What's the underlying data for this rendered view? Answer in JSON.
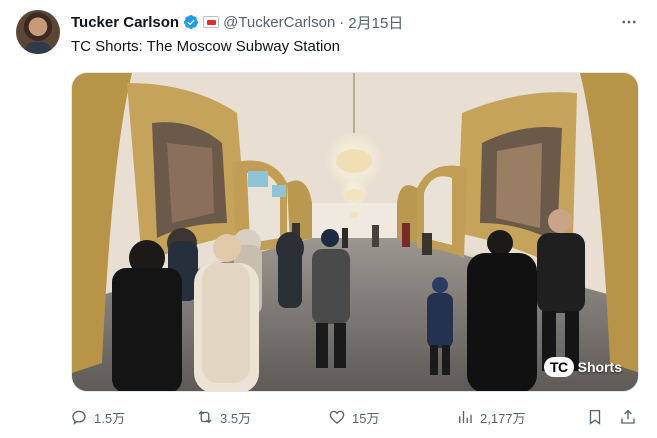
{
  "author": {
    "name": "Tucker Carlson",
    "handle": "@TuckerCarlson",
    "separator": "·",
    "date": "2月15日"
  },
  "tweet": {
    "text": "TC Shorts: The Moscow Subway Station"
  },
  "media": {
    "logo_mark": "TC",
    "logo_text": "Shorts"
  },
  "actions": {
    "replies": "1.5万",
    "reposts": "3.5万",
    "likes": "15万",
    "views": "2,177万"
  },
  "icons": {
    "verified": "verified-badge-icon",
    "more": "more-icon",
    "reply": "reply-icon",
    "repost": "repost-icon",
    "like": "like-icon",
    "views": "views-icon",
    "bookmark": "bookmark-icon",
    "share": "share-icon"
  },
  "colors": {
    "verified_blue": "#1d9bf0",
    "muted_text": "#536471",
    "text": "#0f1419"
  }
}
